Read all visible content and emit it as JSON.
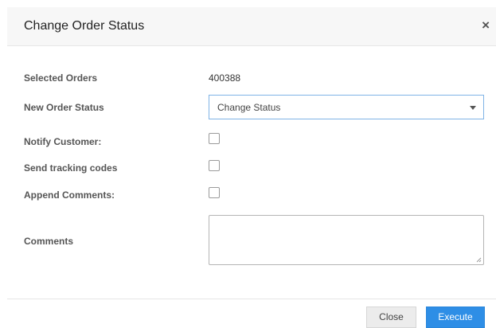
{
  "modal": {
    "title": "Change Order Status",
    "close_icon": "close-icon"
  },
  "form": {
    "selected_orders": {
      "label": "Selected Orders",
      "value": "400388"
    },
    "new_order_status": {
      "label": "New Order Status",
      "selected": "Change Status"
    },
    "notify_customer": {
      "label": "Notify Customer:",
      "checked": false
    },
    "send_tracking_codes": {
      "label": "Send tracking codes",
      "checked": false
    },
    "append_comments": {
      "label": "Append Comments:",
      "checked": false
    },
    "comments": {
      "label": "Comments",
      "value": ""
    }
  },
  "footer": {
    "close_label": "Close",
    "execute_label": "Execute"
  },
  "colors": {
    "accent": "#2e8ee6",
    "header_bg": "#f7f7f7",
    "select_border": "#7fb3e6"
  }
}
